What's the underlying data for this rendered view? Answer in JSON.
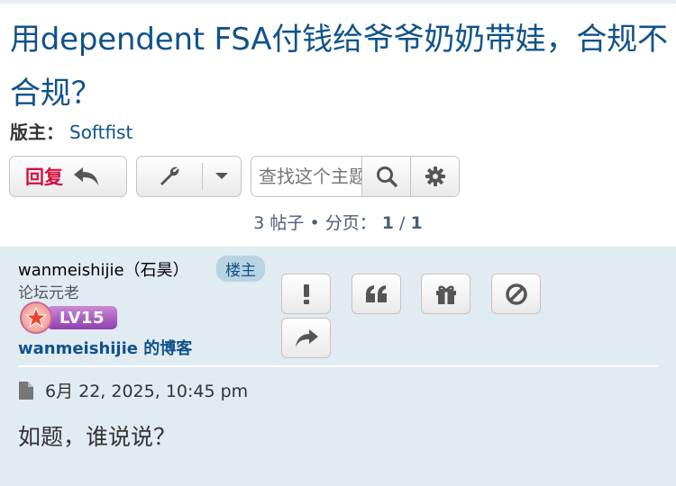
{
  "topic": {
    "title": "用dependent FSA付钱给爷爷奶奶带娃，合规不合规？"
  },
  "moderators": {
    "label": "版主：",
    "name": "Softfist"
  },
  "toolbar": {
    "reply_label": "回复",
    "reply_icon": "reply-arrow-icon",
    "tools_icon": "wrench-icon",
    "tools_dropdown_icon": "caret-down-icon"
  },
  "search": {
    "placeholder": "查找这个主题…",
    "search_icon": "magnifier-icon",
    "advanced_icon": "gear-icon"
  },
  "pagination": {
    "post_count": "3 帖子",
    "bullet": "•",
    "page_label": "分页：",
    "current_page": "1",
    "separator": "/",
    "total_pages": "1"
  },
  "post": {
    "author": "wanmeishijie（石昊）",
    "op_badge": "楼主",
    "rank": "论坛元老",
    "level": "LV15",
    "blog_user": "wanmeishijie",
    "blog_suffix": " 的博客",
    "actions": [
      "report-icon",
      "quote-icon",
      "gift-icon",
      "ban-icon",
      "share-icon"
    ],
    "date": "6月 22, 2025, 10:45 pm",
    "content": "如题，谁说说？"
  },
  "colors": {
    "title": "#105289",
    "reply_text": "#d31141",
    "post_bg": "#e1ebf2",
    "badge_bg": "#b8d4e0"
  }
}
